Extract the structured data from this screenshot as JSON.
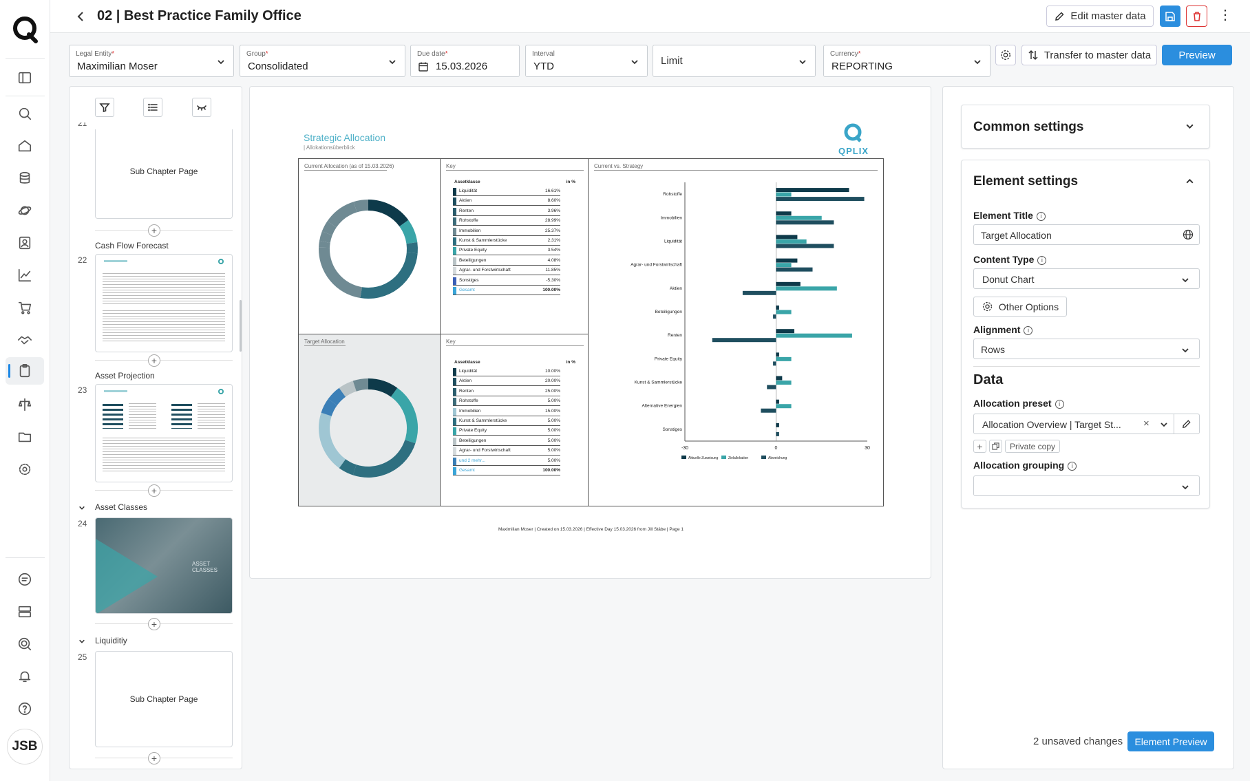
{
  "app": {
    "title": "02 | Best Practice Family Office",
    "avatar_initials": "JSB"
  },
  "toolbar": {
    "edit_master": "Edit master data",
    "transfer": "Transfer to master data",
    "preview": "Preview"
  },
  "filters": {
    "legal_entity": {
      "label": "Legal Entity",
      "value": "Maximilian Moser"
    },
    "group": {
      "label": "Group",
      "value": "Consolidated"
    },
    "due_date": {
      "label": "Due date",
      "value": "15.03.2026"
    },
    "interval": {
      "label": "Interval",
      "value": "YTD"
    },
    "limit": {
      "placeholder": "Limit"
    },
    "currency": {
      "label": "Currency",
      "value": "REPORTING"
    }
  },
  "pages": {
    "partial_num": "21",
    "sub_chapter_1": "Sub Chapter Page",
    "items": [
      {
        "num": "22",
        "title": "Cash Flow Forecast"
      },
      {
        "num": "23",
        "title": "Asset Projection"
      },
      {
        "num": "24",
        "title": "Asset Classes",
        "image_text": "ASSET CLASSES"
      },
      {
        "num": "25",
        "title": "Liquiditiy",
        "sub": "Sub Chapter Page"
      }
    ]
  },
  "report": {
    "title": "Strategic Allocation",
    "subtitle": "| Allokationsüberblick",
    "logo": "QPLIX",
    "panel_current": "Current Allocation (as of 15.03.2026)",
    "panel_target": "Target Allocation",
    "panel_key": "Key",
    "panel_strategy": "Current vs. Strategy",
    "col_asset": "Assetklasse",
    "col_pct": "in %",
    "footer": "Maximilian Moser | Created on 15.03.2026 | Effective Day 15.03.2026 from Jill Stäbe | Page 1",
    "colors": {
      "dark": "#0e3a4a",
      "teal": "#3aa5a8",
      "mid": "#2e6f80",
      "gray": "#6f8a93",
      "light": "#9fc6d3",
      "blue": "#3b7fb7",
      "palegray": "#b9c3c6"
    },
    "key_current": [
      {
        "name": "Liquidität",
        "value": "16.61%",
        "color": "#0e3a4a"
      },
      {
        "name": "Aktien",
        "value": "8.60%",
        "color": "#1f4e5f"
      },
      {
        "name": "Renten",
        "value": "3.96%",
        "color": "#2a5d6d"
      },
      {
        "name": "Rohstoffe",
        "value": "28.99%",
        "color": "#3c6c7a"
      },
      {
        "name": "Immobilien",
        "value": "25.37%",
        "color": "#6f8a93"
      },
      {
        "name": "Kunst & Sammlerstücke",
        "value": "2.31%",
        "color": "#2e6f80"
      },
      {
        "name": "Private Equity",
        "value": "3.54%",
        "color": "#3aa5a8"
      },
      {
        "name": "Beteiligungen",
        "value": "4.08%",
        "color": "#b9c3c6"
      },
      {
        "name": "Agrar- und Forstwirtschaft",
        "value": "11.85%",
        "color": "#d5dadc"
      },
      {
        "name": "Sonstiges",
        "value": "-5.30%",
        "color": "#3b5fb7"
      },
      {
        "name": "Gesamt",
        "value": "100.00%",
        "color": "#3aa5d8",
        "total": true
      }
    ],
    "key_target": [
      {
        "name": "Liquidität",
        "value": "10.00%",
        "color": "#0e3a4a"
      },
      {
        "name": "Aktien",
        "value": "20.00%",
        "color": "#1f4e5f"
      },
      {
        "name": "Renten",
        "value": "25.00%",
        "color": "#2a5d6d"
      },
      {
        "name": "Rohstoffe",
        "value": "5.00%",
        "color": "#3c6c7a"
      },
      {
        "name": "Immobilien",
        "value": "15.00%",
        "color": "#9fc6d3"
      },
      {
        "name": "Kunst & Sammlerstücke",
        "value": "5.00%",
        "color": "#2e6f80"
      },
      {
        "name": "Private Equity",
        "value": "5.00%",
        "color": "#3aa5a8"
      },
      {
        "name": "Beteiligungen",
        "value": "5.00%",
        "color": "#b9c3c6"
      },
      {
        "name": "Agrar- und Forstwirtschaft",
        "value": "5.00%",
        "color": "#d5dadc"
      },
      {
        "name": "und 2 mehr...",
        "value": "5.00%",
        "color": "#3b7fb7",
        "link": true
      },
      {
        "name": "Gesamt",
        "value": "100.00%",
        "color": "#3aa5d8",
        "total": true
      }
    ]
  },
  "chart_data": [
    {
      "type": "pie",
      "title": "Current Allocation (as of 15.03.2026)",
      "categories": [
        "Liquidität",
        "Aktien",
        "Renten",
        "Rohstoffe",
        "Immobilien",
        "Kunst & Sammlerstücke",
        "Private Equity",
        "Beteiligungen",
        "Agrar- und Forstwirtschaft",
        "Sonstiges"
      ],
      "values": [
        16.61,
        8.6,
        3.96,
        28.99,
        25.37,
        2.31,
        3.54,
        4.08,
        11.85,
        -5.3
      ]
    },
    {
      "type": "pie",
      "title": "Target Allocation",
      "categories": [
        "Liquidität",
        "Aktien",
        "Renten",
        "Rohstoffe",
        "Immobilien",
        "Kunst & Sammlerstücke",
        "Private Equity",
        "Beteiligungen",
        "Agrar- und Forstwirtschaft",
        "und 2 mehr..."
      ],
      "values": [
        10,
        20,
        25,
        5,
        15,
        5,
        5,
        5,
        5,
        5
      ]
    },
    {
      "type": "bar",
      "orientation": "horizontal",
      "title": "Current vs. Strategy",
      "categories": [
        "Rohstoffe",
        "Immobilien",
        "Liquidität",
        "Agrar- und Forstwirtschaft",
        "Aktien",
        "Beteiligungen",
        "Renten",
        "Private Equity",
        "Kunst & Sammlerstücke",
        "Alternative Energien",
        "Sonstiges"
      ],
      "xlim": [
        -30,
        30
      ],
      "xticks": [
        -30,
        0,
        30
      ],
      "series": [
        {
          "name": "Aktuelle Zuweisung",
          "values": [
            24,
            5,
            7,
            7,
            8,
            1,
            6,
            1,
            2,
            1,
            1
          ]
        },
        {
          "name": "Zielallokation",
          "values": [
            5,
            15,
            10,
            5,
            20,
            5,
            25,
            5,
            5,
            5,
            0
          ]
        },
        {
          "name": "Abweichung",
          "values": [
            29,
            19,
            19,
            12,
            -11,
            -1,
            -21,
            -1,
            -3,
            -5,
            1
          ]
        }
      ]
    }
  ],
  "settings": {
    "common": "Common settings",
    "element": "Element settings",
    "element_title_label": "Element Title",
    "element_title_value": "Target Allocation",
    "content_type_label": "Content Type",
    "content_type_value": "Donut Chart",
    "other_options": "Other Options",
    "alignment_label": "Alignment",
    "alignment_value": "Rows",
    "data_heading": "Data",
    "allocation_preset_label": "Allocation preset",
    "allocation_preset_value": "Allocation Overview | Target St...",
    "private_copy": "Private copy",
    "allocation_grouping_label": "Allocation grouping",
    "unsaved": "2 unsaved changes",
    "element_preview": "Element Preview"
  }
}
